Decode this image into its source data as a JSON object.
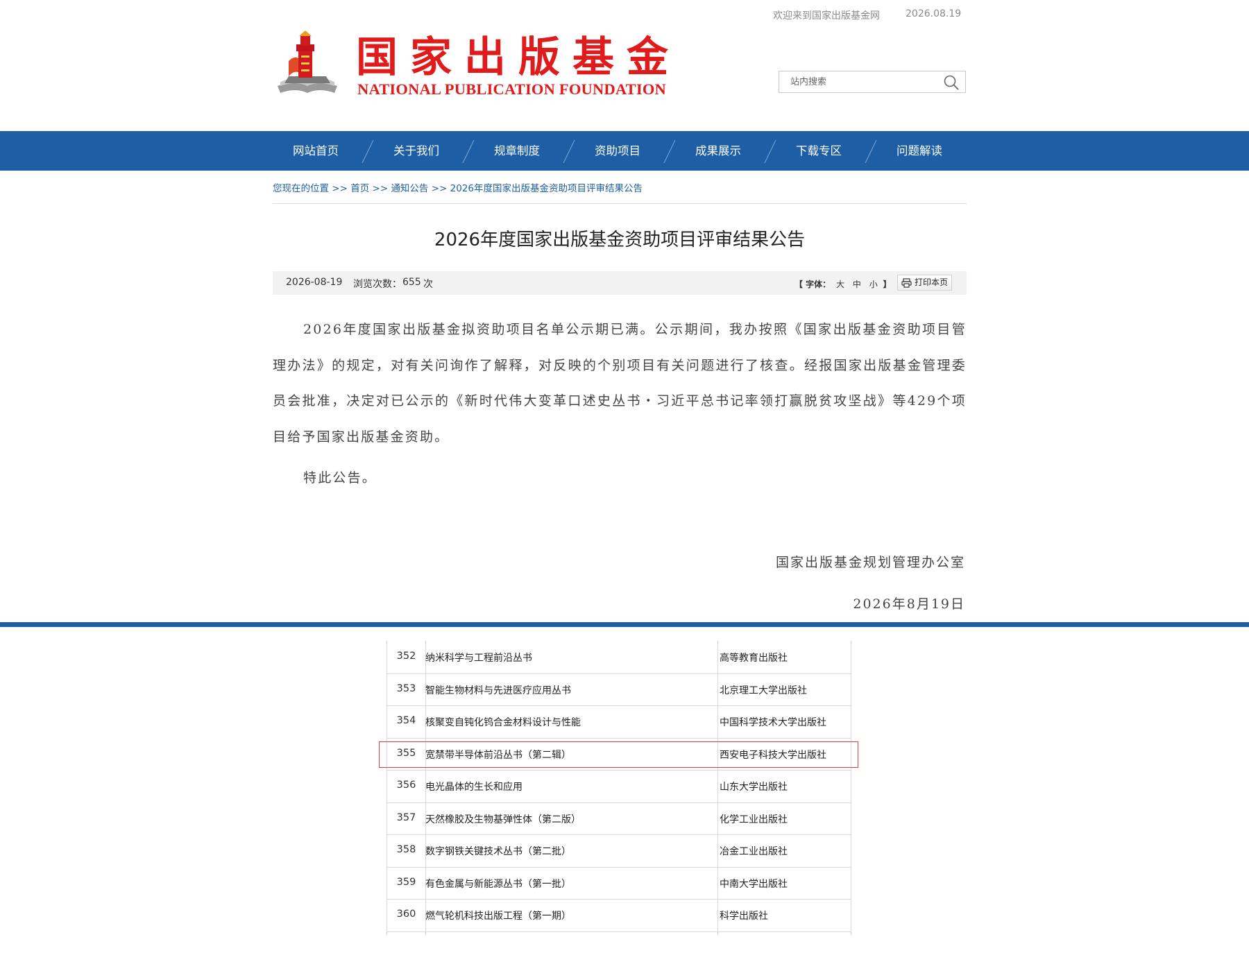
{
  "header": {
    "welcome": "欢迎来到国家出版基金网",
    "date": "2026.08.19",
    "logo_cn": "国家出版基金",
    "logo_en": "NATIONAL PUBLICATION FOUNDATION",
    "search_placeholder": "站内搜索",
    "brand_color": "#e01b1b"
  },
  "nav": {
    "items": [
      "网站首页",
      "关于我们",
      "规章制度",
      "资助项目",
      "成果展示",
      "下载专区",
      "问题解读"
    ],
    "color": "#1d5ea4"
  },
  "breadcrumb": {
    "prefix": "您现在的位置",
    "items": [
      "首页",
      "通知公告",
      "2026年度国家出版基金资助项目评审结果公告"
    ],
    "separator": ">>"
  },
  "article": {
    "title": "2026年度国家出版基金资助项目评审结果公告",
    "date": "2026-08-19",
    "views_label": "浏览次数：",
    "views": "655",
    "views_unit": "次",
    "font_label": "【 字体：",
    "font_sizes": [
      "大",
      "中",
      "小"
    ],
    "font_end": "】",
    "print_label": "打印本页",
    "paragraph1": "2026年度国家出版基金拟资助项目名单公示期已满。公示期间，我办按照《国家出版基金资助项目管理办法》的规定，对有关问询作了解释，对反映的个别项目有关问题进行了核查。经报国家出版基金管理委员会批准，决定对已公示的《新时代伟大变革口述史丛书・习近平总书记率领打赢脱贫攻坚战》等429个项目给予国家出版基金资助。",
    "paragraph2": "特此公告。",
    "signature_org": "国家出版基金规划管理办公室",
    "signature_date": "2026年8月19日"
  },
  "table": {
    "highlight_color": "#e03c3c",
    "rows": [
      {
        "no": "352",
        "name": "纳米科学与工程前沿丛书",
        "publisher": "高等教育出版社"
      },
      {
        "no": "353",
        "name": "智能生物材料与先进医疗应用丛书",
        "publisher": "北京理工大学出版社"
      },
      {
        "no": "354",
        "name": "核聚变自钝化钨合金材料设计与性能",
        "publisher": "中国科学技术大学出版社"
      },
      {
        "no": "355",
        "name": "宽禁带半导体前沿丛书（第二辑）",
        "publisher": "西安电子科技大学出版社"
      },
      {
        "no": "356",
        "name": "电光晶体的生长和应用",
        "publisher": "山东大学出版社"
      },
      {
        "no": "357",
        "name": "天然橡胶及生物基弹性体（第二版）",
        "publisher": "化学工业出版社"
      },
      {
        "no": "358",
        "name": "数字钢铁关键技术丛书（第二批）",
        "publisher": "冶金工业出版社"
      },
      {
        "no": "359",
        "name": "有色金属与新能源丛书（第一批）",
        "publisher": "中南大学出版社"
      },
      {
        "no": "360",
        "name": "燃气轮机科技出版工程（第一期）",
        "publisher": "科学出版社"
      }
    ],
    "highlighted_row": "355"
  }
}
